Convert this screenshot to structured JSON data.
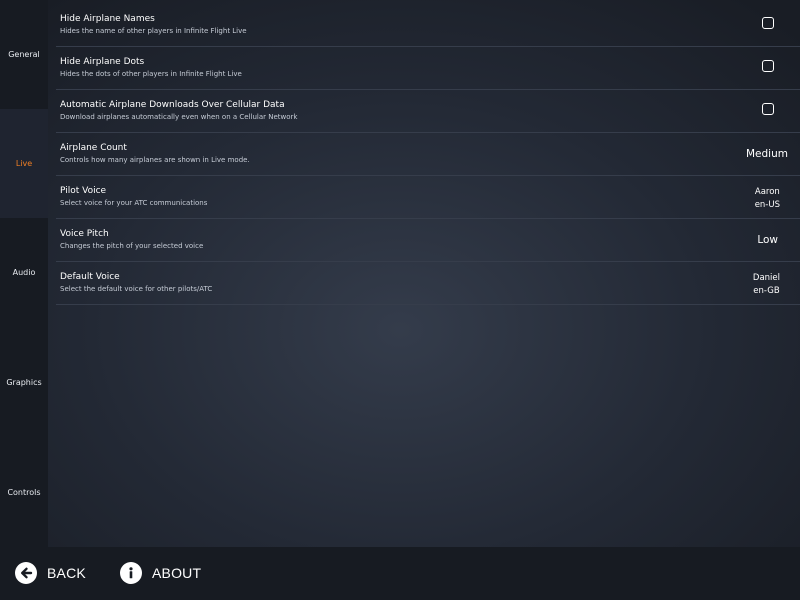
{
  "sidebar": {
    "items": [
      {
        "label": "General"
      },
      {
        "label": "Live"
      },
      {
        "label": "Audio"
      },
      {
        "label": "Graphics"
      },
      {
        "label": "Controls"
      }
    ],
    "active": "Live",
    "active_color": "#f07f24"
  },
  "settings": [
    {
      "title": "Hide Airplane Names",
      "description": "Hides the name of other players in Infinite Flight Live",
      "control": "checkbox",
      "checked": false
    },
    {
      "title": "Hide Airplane Dots",
      "description": "Hides the dots of other players in Infinite Flight Live",
      "control": "checkbox",
      "checked": false
    },
    {
      "title": "Automatic Airplane Downloads Over Cellular Data",
      "description": "Download airplanes automatically even when on a Cellular Network",
      "control": "checkbox",
      "checked": false
    },
    {
      "title": "Airplane Count",
      "description": "Controls how many airplanes are shown in Live mode.",
      "control": "value",
      "value": "Medium"
    },
    {
      "title": "Pilot Voice",
      "description": "Select voice for your ATC communications",
      "control": "voice",
      "voice_name": "Aaron",
      "voice_locale": "en-US"
    },
    {
      "title": "Voice Pitch",
      "description": "Changes the pitch of your selected voice",
      "control": "value",
      "value": "Low"
    },
    {
      "title": "Default Voice",
      "description": "Select the default voice for other pilots/ATC",
      "control": "voice",
      "voice_name": "Daniel",
      "voice_locale": "en-GB"
    }
  ],
  "bottom_bar": {
    "back_label": "BACK",
    "back_icon": "arrow-left-circle-icon",
    "about_label": "ABOUT",
    "about_icon": "info-circle-icon"
  }
}
